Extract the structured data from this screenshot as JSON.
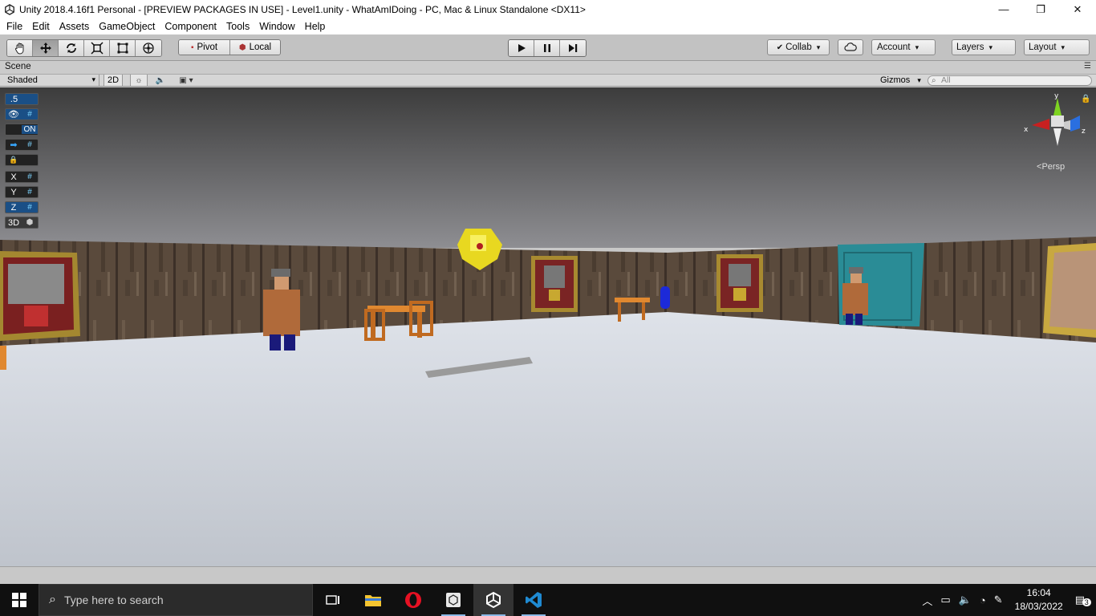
{
  "window": {
    "title": "Unity 2018.4.16f1 Personal - [PREVIEW PACKAGES IN USE] - Level1.unity - WhatAmIDoing - PC, Mac & Linux Standalone <DX11>",
    "minimize": "—",
    "maximize": "❐",
    "close": "✕"
  },
  "menu": [
    "File",
    "Edit",
    "Assets",
    "GameObject",
    "Component",
    "Tools",
    "Window",
    "Help"
  ],
  "toolbar": {
    "pivot_label": "Pivot",
    "local_label": "Local",
    "collab_label": "Collab",
    "account_label": "Account",
    "layers_label": "Layers",
    "layout_label": "Layout"
  },
  "scene": {
    "tab_label": "Scene",
    "shading_mode": "Shaded",
    "mode_2d": "2D",
    "gizmos_label": "Gizmos",
    "search_placeholder": "All",
    "projection": "Persp"
  },
  "overlay_toggles": [
    {
      "left": ".5",
      "right": ""
    },
    {
      "left": "👁",
      "right": "#"
    },
    {
      "left": "",
      "right": "ON"
    },
    {
      "left": "➡",
      "right": "#"
    },
    {
      "left": "🔒",
      "right": ""
    },
    {
      "left": "X",
      "right": "#"
    },
    {
      "left": "Y",
      "right": "#"
    },
    {
      "left": "Z",
      "right": "#"
    },
    {
      "left": "3D",
      "right": "⬢"
    }
  ],
  "gizmo_axes": {
    "x": "x",
    "y": "y",
    "z": "z"
  },
  "taskbar": {
    "search_placeholder": "Type here to search",
    "time": "16:04",
    "date": "18/03/2022",
    "notifications": "3"
  },
  "colors": {
    "ceiling": "#4a4a4a",
    "floor": "#c4cad3",
    "wall": "#5b4a3c",
    "door": "#2a8c96",
    "taskbar": "#101010"
  }
}
